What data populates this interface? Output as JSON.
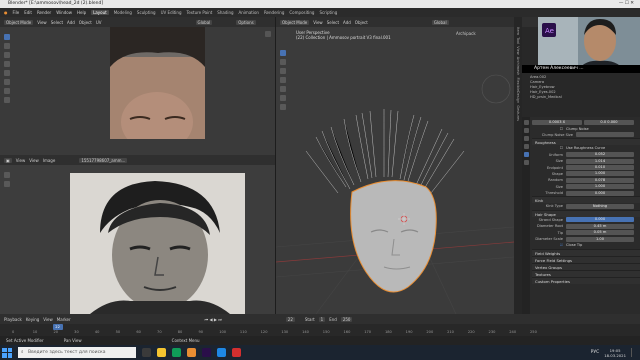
{
  "window": {
    "title": "Blender* [E:\\ammosov\\head_2d (2).blend]"
  },
  "menu": [
    "File",
    "Edit",
    "Render",
    "Window",
    "Help"
  ],
  "workspaces": [
    {
      "label": "Layout",
      "active": true
    },
    {
      "label": "Modeling",
      "active": false
    },
    {
      "label": "Sculpting",
      "active": false
    },
    {
      "label": "UV Editing",
      "active": false
    },
    {
      "label": "Texture Paint",
      "active": false
    },
    {
      "label": "Shading",
      "active": false
    },
    {
      "label": "Animation",
      "active": false
    },
    {
      "label": "Rendering",
      "active": false
    },
    {
      "label": "Compositing",
      "active": false
    },
    {
      "label": "Scripting",
      "active": false
    }
  ],
  "top_left_view": {
    "mode": "Object Mode",
    "menu": [
      "View",
      "Select",
      "Add",
      "Object",
      "UV"
    ],
    "global": "Global",
    "options": "Options"
  },
  "image_editor": {
    "menu": [
      "View",
      "View",
      "Image"
    ],
    "image_name": "15517798607_amm..."
  },
  "viewport": {
    "line1": "User Perspective",
    "line2": "(22) Collection | Ammosov portrait V3 final.001",
    "archpack": "Archipack"
  },
  "outliner": {
    "user": "Артем Алексеевич ...",
    "rows": [
      "Area.002",
      "Camera",
      "Hair_Eyebrow",
      "Hair_Eyes.002",
      "HD_prsin_Medical"
    ]
  },
  "properties": {
    "top_values": [
      "0.0003 X",
      "0.0 0.000"
    ],
    "clump_noise": "Clump Noise",
    "clump_noise_size": "Clump Noise Size",
    "roughness": "Roughness",
    "use_roughness_curve": "Use Roughness Curve",
    "rough_rows": [
      {
        "label": "Uniform",
        "value": "0.052"
      },
      {
        "label": "Size",
        "value": "1.014"
      },
      {
        "label": "Endpoint",
        "value": "0.010"
      },
      {
        "label": "Shape",
        "value": "1.000"
      },
      {
        "label": "Random",
        "value": "0.078"
      },
      {
        "label": "Size",
        "value": "1.000"
      },
      {
        "label": "Threshold",
        "value": "0.000"
      }
    ],
    "kink": "Kink",
    "kink_type_label": "Kink Type",
    "kink_type_value": "Nothing",
    "hair_shape": "Hair Shape",
    "shape_rows": [
      {
        "label": "Strand Shape",
        "value": "0.000",
        "blue": true
      },
      {
        "label": "Diameter Root",
        "value": "0.45 m",
        "blue": false
      },
      {
        "label": "Tip",
        "value": "0.05 m",
        "blue": false
      },
      {
        "label": "Diameter Scale",
        "value": "1.00",
        "blue": false
      }
    ],
    "close_tip": "Close Tip",
    "collapsed_sections": [
      "Field Weights",
      "Force Field Settings",
      "Vertex Groups",
      "Textures",
      "Custom Properties"
    ]
  },
  "side_tabs": [
    "Item",
    "Tool",
    "View",
    "Archimesh",
    "FlexibleDesign",
    "Gestures",
    "FaceBuilder",
    "CDA Tools",
    "Unfold",
    "Properties"
  ],
  "timeline": {
    "menu": [
      "Playback",
      "Keying",
      "View",
      "Marker"
    ],
    "current_frame": "22",
    "start_label": "Start",
    "start": "1",
    "end_label": "End",
    "end": "250",
    "ticks": [
      "0",
      "10",
      "20",
      "30",
      "40",
      "50",
      "60",
      "70",
      "80",
      "90",
      "100",
      "110",
      "120",
      "130",
      "140",
      "150",
      "160",
      "170",
      "180",
      "190",
      "200",
      "210",
      "220",
      "230",
      "240",
      "250"
    ],
    "current_frame_value": 22
  },
  "statusbar": {
    "left1": "Set Active Modifier",
    "left2": "Pan View",
    "mid": "Context Menu"
  },
  "taskbar": {
    "search_placeholder": "Введите здесь текст для поиска",
    "time": "19:05",
    "date": "18.03.2021",
    "lang": "РУС"
  },
  "colors": {
    "accent": "#4772b3",
    "selected_outline": "#e98e33",
    "taskbar": "#1b2430"
  }
}
